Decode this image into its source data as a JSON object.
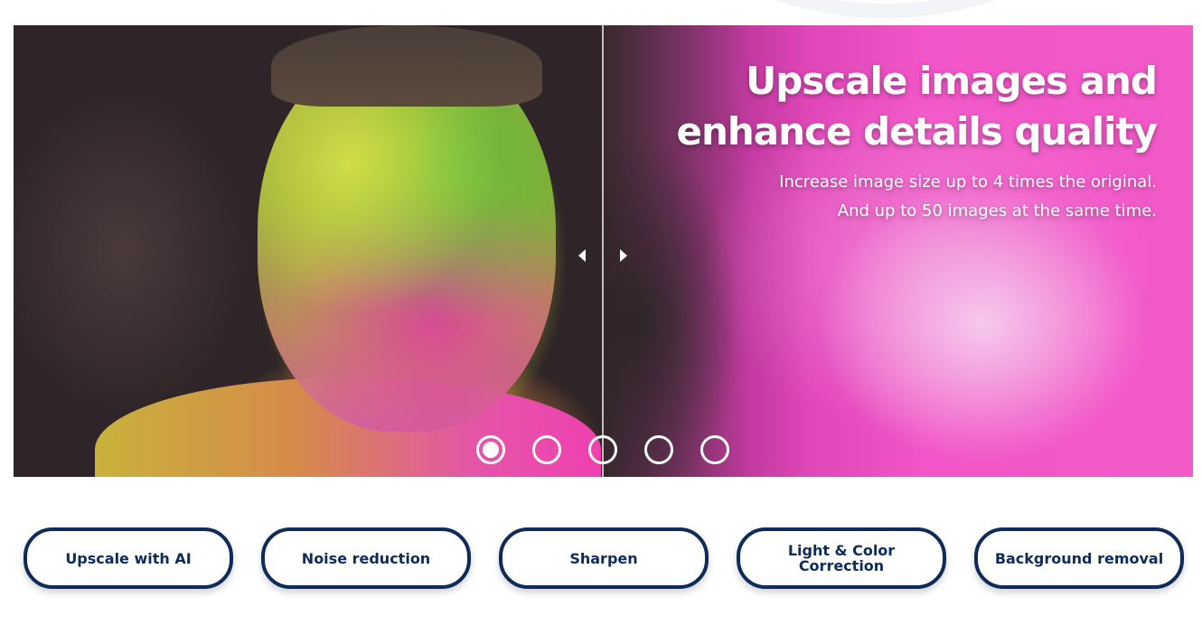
{
  "hero": {
    "title": "Upscale images and enhance details quality",
    "subtitle_line1": "Increase image size up to 4 times the original.",
    "subtitle_line2": "And up to 50 images at the same time.",
    "arrow_left_icon": "triangle-left-icon",
    "arrow_right_icon": "triangle-right-icon",
    "image_description_colors": {
      "pink": "#f255c7",
      "green": "#5fbf3c",
      "yellow": "#d9e24a"
    }
  },
  "slider": {
    "total_slides": 5,
    "active_index": 0
  },
  "features": [
    {
      "label": "Upscale with AI"
    },
    {
      "label": "Noise reduction"
    },
    {
      "label": "Sharpen"
    },
    {
      "label": "Light & Color Correction"
    },
    {
      "label": "Background removal"
    }
  ],
  "colors": {
    "button_border": "#0e2b5c",
    "button_text": "#0e2b5c",
    "background": "#ffffff"
  }
}
